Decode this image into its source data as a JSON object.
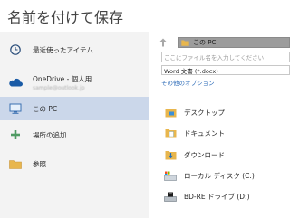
{
  "title": "名前を付けて保存",
  "nav": {
    "recent": "最近使ったアイテム",
    "onedrive_label": "OneDrive - 個人用",
    "onedrive_account": "sample@outlook.jp",
    "this_pc": "この PC",
    "add_place": "場所の追加",
    "browse": "参照"
  },
  "address": "この PC",
  "filename_placeholder": "ここにファイル名を入力してください",
  "filetype": "Word 文書 (*.docx)",
  "more_options": "その他のオプション",
  "locations": [
    {
      "label": "デスクトップ",
      "icon": "desktop-folder-icon"
    },
    {
      "label": "ドキュメント",
      "icon": "documents-folder-icon"
    },
    {
      "label": "ダウンロード",
      "icon": "downloads-folder-icon"
    },
    {
      "label": "ローカル ディスク (C:)",
      "icon": "local-disk-icon"
    },
    {
      "label": "BD-RE ドライブ (D:)",
      "icon": "bd-drive-icon"
    }
  ],
  "colors": {
    "selected_bg": "#cbd7ea",
    "nav_bg": "#f3f3f3",
    "folder": "#e8b64d",
    "link": "#2e6cb8",
    "plus": "#4e9a62",
    "onedrive": "#1a5ba6"
  }
}
